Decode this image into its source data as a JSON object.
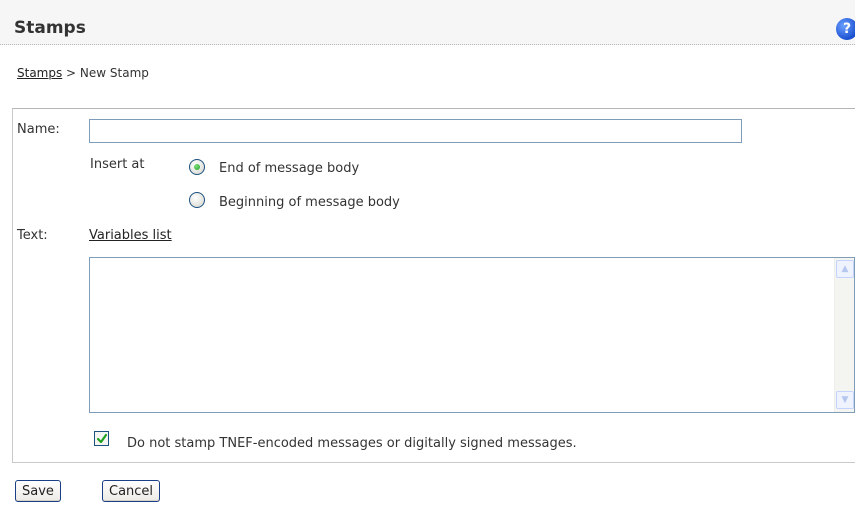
{
  "header": {
    "title": "Stamps",
    "help_icon_glyph": "?",
    "help_icon_color": "#1a4fd0"
  },
  "breadcrumb": {
    "link": "Stamps",
    "separator": " > ",
    "current": "New Stamp"
  },
  "form": {
    "name_label": "Name:",
    "name_value": "",
    "insert_at_label": "Insert at",
    "insert_options": [
      {
        "label": "End of message body",
        "checked": true
      },
      {
        "label": "Beginning of message body",
        "checked": false
      }
    ],
    "text_label": "Text:",
    "variables_link": "Variables list",
    "text_value": "",
    "tnef_checkbox_label": "Do not stamp TNEF-encoded messages or digitally signed messages.",
    "tnef_checked": true
  },
  "buttons": {
    "save": "Save",
    "cancel": "Cancel"
  },
  "colors": {
    "header_bg": "#f6f6f6",
    "input_border": "#7f9db9",
    "radio_dot": "#21a121",
    "check_mark": "#21a121"
  }
}
